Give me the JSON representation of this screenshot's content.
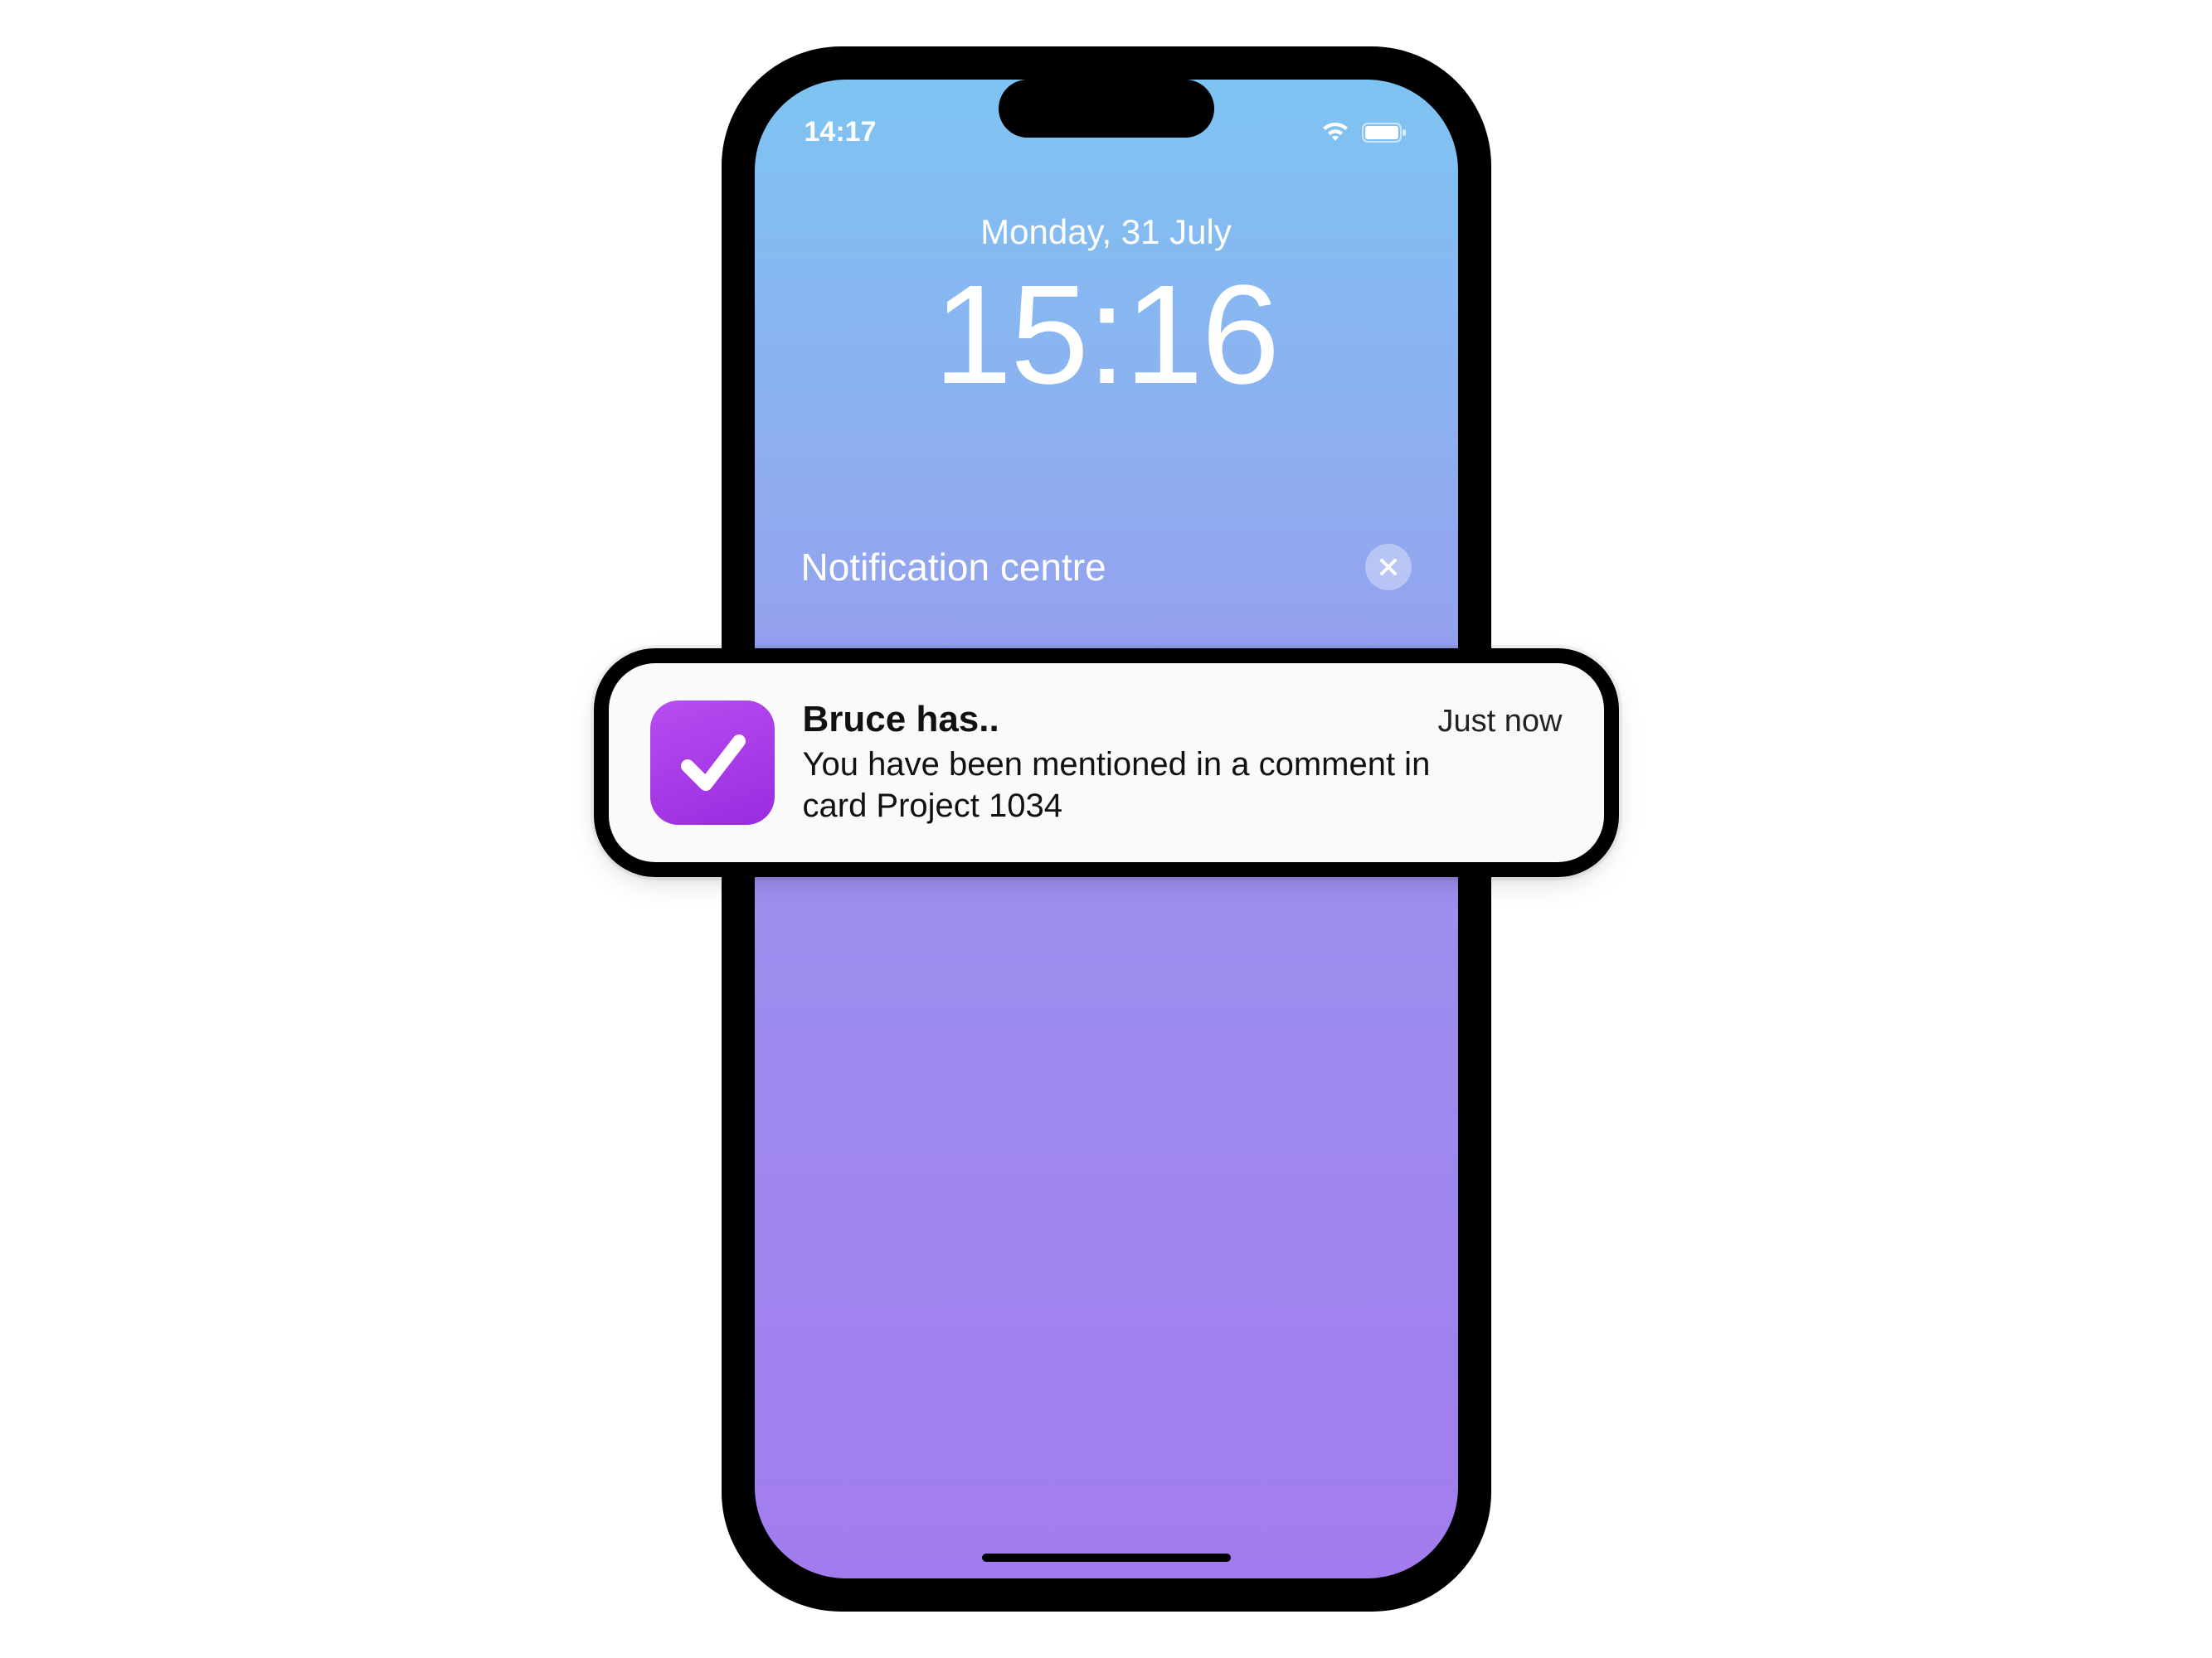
{
  "status_bar": {
    "time": "14:17"
  },
  "lockscreen": {
    "date": "Monday, 31 July",
    "time": "15:16"
  },
  "notification_centre": {
    "title": "Notification centre"
  },
  "notification": {
    "app_icon_name": "checkmark-app-icon",
    "title": "Bruce has..",
    "timestamp": "Just now",
    "message": "You have been mentioned in a comment in card Project 1034"
  },
  "colors": {
    "app_icon_bg_start": "#b84df0",
    "app_icon_bg_end": "#9a2be0",
    "screen_gradient_top": "#7ec4f2",
    "screen_gradient_bottom": "#a27cee"
  }
}
